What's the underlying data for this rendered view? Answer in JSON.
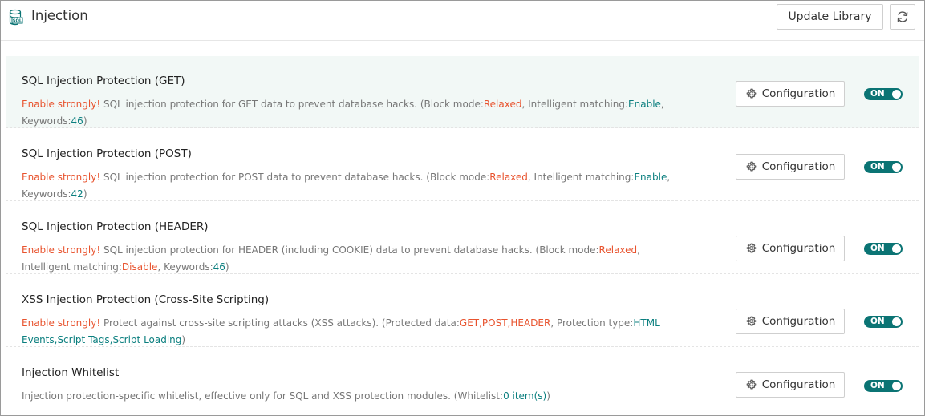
{
  "header": {
    "title": "Injection",
    "logo_icon": "database-sql-icon",
    "update_library_label": "Update Library",
    "refresh_icon": "refresh-icon"
  },
  "accent_color": "#0b7474",
  "warning_color": "#e8532e",
  "rows": [
    {
      "title": "SQL Injection Protection (GET)",
      "warning": "Enable strongly!",
      "text": " SQL injection protection for GET data to prevent database hacks. (Block mode:",
      "block_mode": "Relaxed",
      "text2": ", Intelligent matching:",
      "intelligent": "Enable",
      "text3": ", Keywords:",
      "keywords": "46",
      "text4": ")",
      "config_label": "Configuration",
      "toggle_label": "ON"
    },
    {
      "title": "SQL Injection Protection (POST)",
      "warning": "Enable strongly!",
      "text": " SQL injection protection for POST data to prevent database hacks. (Block mode:",
      "block_mode": "Relaxed",
      "text2": ", Intelligent matching:",
      "intelligent": "Enable",
      "text3": ", Keywords:",
      "keywords": "42",
      "text4": ")",
      "config_label": "Configuration",
      "toggle_label": "ON"
    },
    {
      "title": "SQL Injection Protection (HEADER)",
      "warning": "Enable strongly!",
      "text": " SQL injection protection for HEADER (including COOKIE) data to prevent database hacks. (Block mode:",
      "block_mode": "Relaxed",
      "text2": ", Intelligent matching:",
      "intelligent": "Disable",
      "text3": ", Keywords:",
      "keywords": "46",
      "text4": ")",
      "config_label": "Configuration",
      "toggle_label": "ON"
    },
    {
      "title": "XSS Injection Protection (Cross-Site Scripting)",
      "warning": "Enable strongly!",
      "text": " Protect against cross-site scripting attacks (XSS attacks). (Protected data:",
      "protected_data": "GET,POST,HEADER",
      "text2": ", Protection type:",
      "protection_type": "HTML Events,Script Tags,Script Loading",
      "text3": ")",
      "config_label": "Configuration",
      "toggle_label": "ON"
    },
    {
      "title": "Injection Whitelist",
      "text": "Injection protection-specific whitelist, effective only for SQL and XSS protection modules. (Whitelist:",
      "whitelist": "0 item(s)",
      "text2": ")",
      "config_label": "Configuration",
      "toggle_label": "ON"
    }
  ]
}
